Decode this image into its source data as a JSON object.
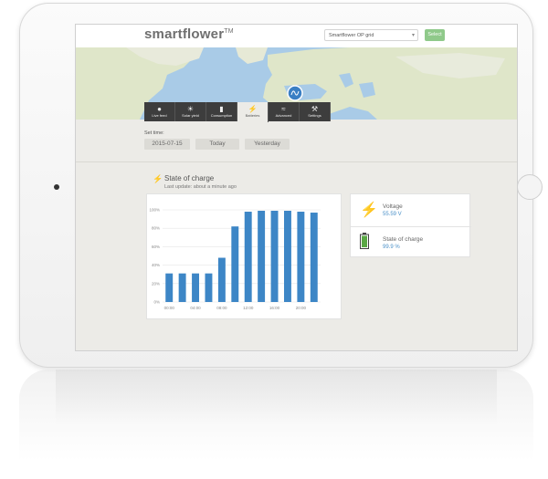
{
  "app": {
    "brand": "smartflower",
    "brand_mark": "TM",
    "device_select": "Smartflower OP grid",
    "select_button": "Select"
  },
  "nav": {
    "tabs": [
      {
        "label": "Live feed",
        "icon": "droplet-icon"
      },
      {
        "label": "Solar yield",
        "icon": "sun-icon"
      },
      {
        "label": "Consumption",
        "icon": "bar-chart-icon"
      },
      {
        "label": "Batteries",
        "icon": "lightning-icon",
        "active": true
      },
      {
        "label": "Advanced",
        "icon": "graph-icon"
      },
      {
        "label": "Settings",
        "icon": "wrench-icon"
      }
    ]
  },
  "time": {
    "label": "Set time:",
    "date": "2015-07-15",
    "today": "Today",
    "yesterday": "Yesterday"
  },
  "section": {
    "title": "State of charge",
    "subtitle": "Last update: about a minute ago"
  },
  "stats": {
    "voltage_label": "Voltage",
    "voltage_value": "55.59 V",
    "soc_label": "State of charge",
    "soc_value": "99.9 %"
  },
  "colors": {
    "bar": "#3d86c6",
    "nav_bg": "#3d3d3d",
    "accent_green": "#8fc98a",
    "bolt": "#f0a020",
    "battery": "#5aa845"
  },
  "chart_data": {
    "type": "bar",
    "x_ticks": [
      "00:00",
      "04:00",
      "08:00",
      "12:00",
      "16:00",
      "20:00"
    ],
    "y_ticks": [
      "0%",
      "20%",
      "40%",
      "60%",
      "80%",
      "100%"
    ],
    "ylim": [
      0,
      100
    ],
    "values": [
      31,
      31,
      31,
      31,
      48,
      82,
      98,
      99,
      99,
      99,
      98,
      97
    ],
    "grid": true
  }
}
